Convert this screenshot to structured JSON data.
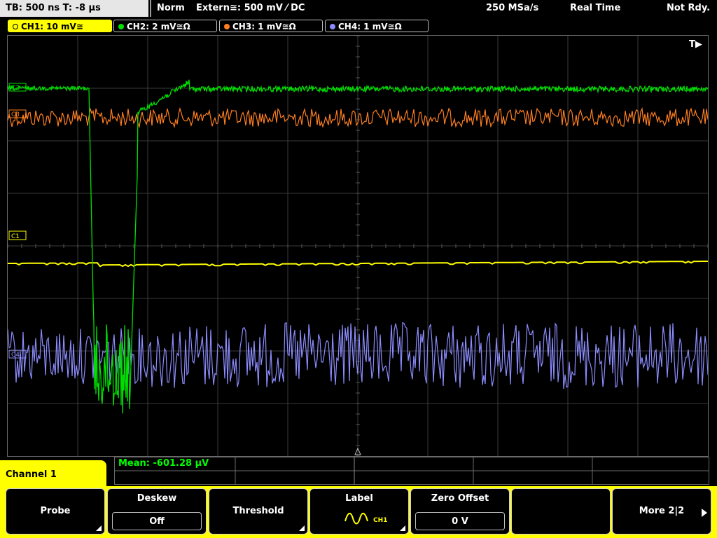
{
  "status": {
    "tb": "TB: 500 ns   T: -8 µs",
    "trigger_mode": "Norm",
    "trigger_source": "Extern≅: 500 mV ⁄ DC",
    "sample_rate": "250 MSa/s",
    "acq_mode": "Real Time",
    "state": "Not Rdy."
  },
  "channels": [
    {
      "label": "CH1: 10 mV≅",
      "color": "#ffff00"
    },
    {
      "label": "CH2: 2 mV≅Ω",
      "color": "#00e000"
    },
    {
      "label": "CH3: 1 mV≅Ω",
      "color": "#ff7f20"
    },
    {
      "label": "CH4: 1 mV≅Ω",
      "color": "#8c8cff"
    }
  ],
  "markers": {
    "ch2": "C2",
    "ch3": "C3",
    "ch1": "C1",
    "ch4": "C4",
    "trigger": "T▶"
  },
  "measurement": {
    "mean": "Mean: -601.28 µV"
  },
  "menu": {
    "title": "Channel 1",
    "softkeys": {
      "probe": "Probe",
      "deskew": "Deskew",
      "deskew_value": "Off",
      "threshold": "Threshold",
      "label": "Label",
      "label_ch": "CH1",
      "zero_offset": "Zero Offset",
      "zero_offset_value": "0 V",
      "more": "More 2|2"
    }
  }
}
